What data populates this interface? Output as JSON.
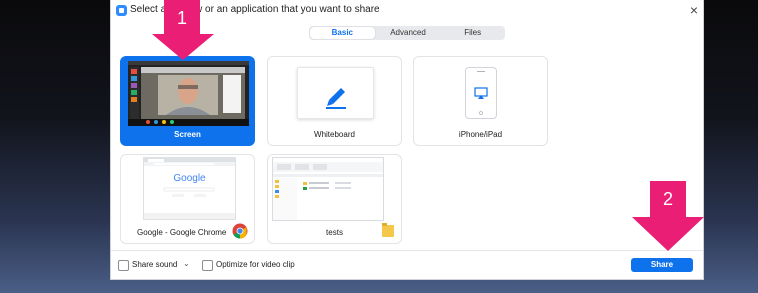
{
  "window": {
    "title": "Select a window or an application that you want to share",
    "close_glyph": "×"
  },
  "tabs": [
    {
      "label": "Basic",
      "active": true
    },
    {
      "label": "Advanced"
    },
    {
      "label": "Files"
    }
  ],
  "tiles": [
    {
      "label": "Screen",
      "selected": true
    },
    {
      "label": "Whiteboard"
    },
    {
      "label": "iPhone/iPad"
    },
    {
      "label": "Google - Google Chrome",
      "thumb_text": "Google"
    },
    {
      "label": "tests"
    }
  ],
  "options": {
    "share_sound": "Share sound",
    "sound_caret": "⌄",
    "optimize_video": "Optimize for video clip"
  },
  "share_button": "Share",
  "annotations": [
    {
      "label": "1"
    },
    {
      "label": "2"
    }
  ],
  "colors": {
    "accent": "#0e72ed",
    "annotation": "#e91e74"
  },
  "icons": [
    "pencil-icon",
    "airplay-icon",
    "chrome-icon",
    "folder-icon",
    "close-icon"
  ]
}
